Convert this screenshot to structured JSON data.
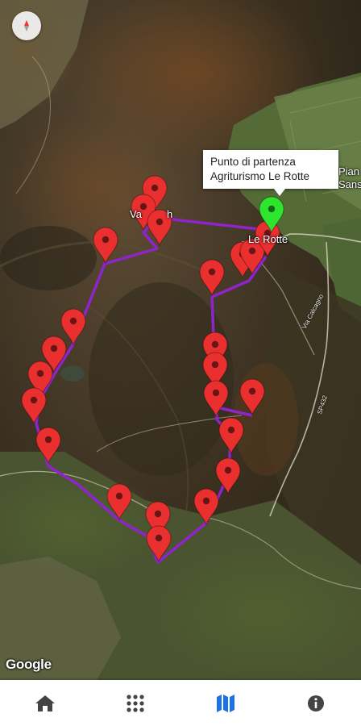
{
  "map": {
    "place_labels": [
      "Va",
      "h",
      "Le Rotte",
      "Pian",
      "Sansi"
    ],
    "road_labels": [
      "Via Calcagno",
      "SP432"
    ],
    "attribution": "Google",
    "compass_icon": "compass-icon",
    "route_color": "#8e24c9",
    "marker_color": "#ea2f2f",
    "start_marker_color": "#2ee52e"
  },
  "info_window": {
    "line1": "Punto di partenza",
    "line2": "Agriturismo Le Rotte"
  },
  "bottom_nav": {
    "items": [
      {
        "icon": "home-icon",
        "selected": false
      },
      {
        "icon": "grid-icon",
        "selected": false
      },
      {
        "icon": "map-icon",
        "selected": true
      },
      {
        "icon": "info-icon",
        "selected": false
      }
    ],
    "active_color": "#1a73e8",
    "inactive_color": "#444444"
  }
}
